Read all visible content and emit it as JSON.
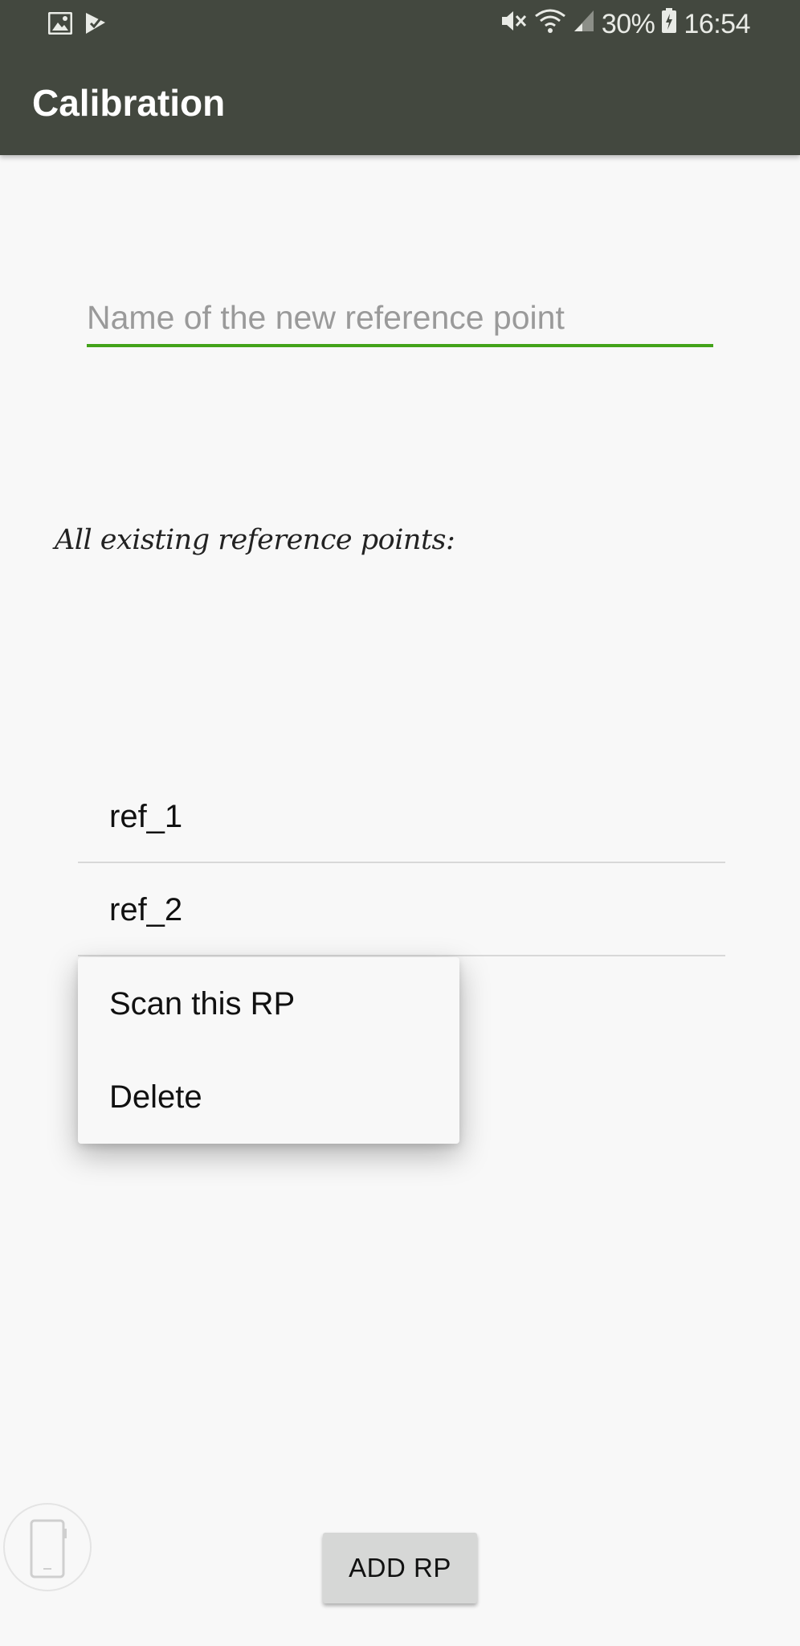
{
  "status_bar": {
    "battery_percent": "30%",
    "time": "16:54",
    "icons": [
      "gallery-icon",
      "task-check-icon",
      "mute-icon",
      "wifi-icon",
      "signal-icon",
      "battery-charging-icon"
    ]
  },
  "app_bar": {
    "title": "Calibration"
  },
  "form": {
    "name_placeholder": "Name of the new reference point",
    "name_value": ""
  },
  "existing": {
    "label": "All existing reference points:",
    "items": [
      "ref_1",
      "ref_2"
    ]
  },
  "context_menu": {
    "items": [
      "Scan this RP",
      "Delete"
    ]
  },
  "actions": {
    "add_rp_label": "ADD RP"
  },
  "colors": {
    "header": "#43483f",
    "accent_underline": "#43a31a",
    "background": "#f8f8f8"
  }
}
